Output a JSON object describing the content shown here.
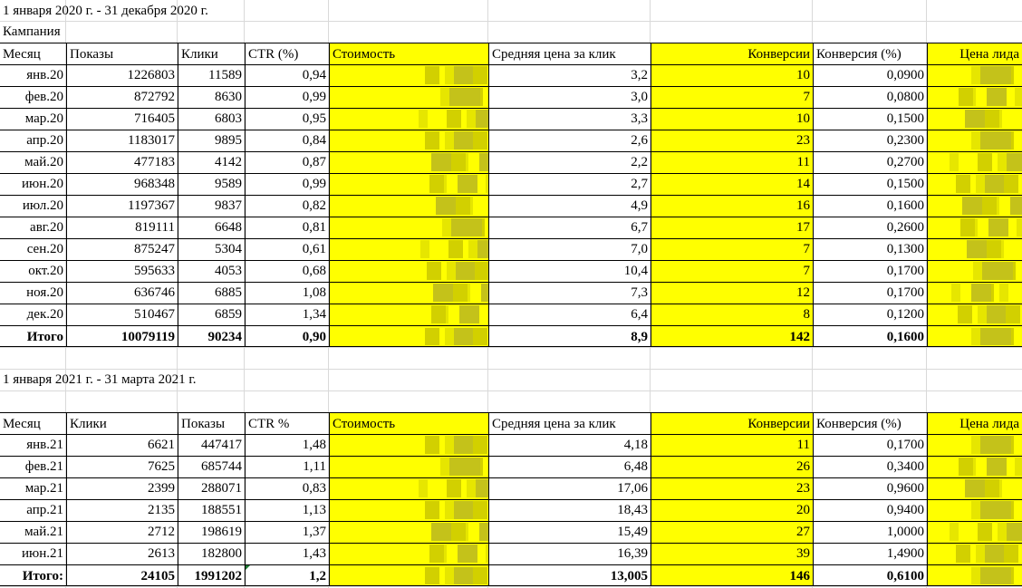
{
  "table1": {
    "title": "1 января 2020 г. - 31 декабря 2020 г.",
    "subtitle": "Кампания",
    "headers": [
      "Месяц",
      "Показы",
      "Клики",
      "CTR (%)",
      "Стоимость",
      "Средняя цена за клик",
      "Конверсии",
      "Конверсия (%)",
      "Цена лида"
    ],
    "rows": [
      [
        "янв.20",
        "1226803",
        "11589",
        "0,94",
        "",
        "3,2",
        "10",
        "0,0900",
        ""
      ],
      [
        "фев.20",
        "872792",
        "8630",
        "0,99",
        "",
        "3,0",
        "7",
        "0,0800",
        ""
      ],
      [
        "мар.20",
        "716405",
        "6803",
        "0,95",
        "",
        "3,3",
        "10",
        "0,1500",
        ""
      ],
      [
        "апр.20",
        "1183017",
        "9895",
        "0,84",
        "",
        "2,6",
        "23",
        "0,2300",
        ""
      ],
      [
        "май.20",
        "477183",
        "4142",
        "0,87",
        "",
        "2,2",
        "11",
        "0,2700",
        ""
      ],
      [
        "июн.20",
        "968348",
        "9589",
        "0,99",
        "",
        "2,7",
        "14",
        "0,1500",
        ""
      ],
      [
        "июл.20",
        "1197367",
        "9837",
        "0,82",
        "",
        "4,9",
        "16",
        "0,1600",
        ""
      ],
      [
        "авг.20",
        "819111",
        "6648",
        "0,81",
        "",
        "6,7",
        "17",
        "0,2600",
        ""
      ],
      [
        "сен.20",
        "875247",
        "5304",
        "0,61",
        "",
        "7,0",
        "7",
        "0,1300",
        ""
      ],
      [
        "окт.20",
        "595633",
        "4053",
        "0,68",
        "",
        "10,4",
        "7",
        "0,1700",
        ""
      ],
      [
        "ноя.20",
        "636746",
        "6885",
        "1,08",
        "",
        "7,3",
        "12",
        "0,1700",
        ""
      ],
      [
        "дек.20",
        "510467",
        "6859",
        "1,34",
        "",
        "6,4",
        "8",
        "0,1200",
        ""
      ]
    ],
    "total": [
      "Итого",
      "10079119",
      "90234",
      "0,90",
      "",
      "8,9",
      "142",
      "0,1600",
      ""
    ]
  },
  "table2": {
    "title": "1 января 2021 г. - 31 марта 2021 г.",
    "headers": [
      "Месяц",
      "Клики",
      "Показы",
      "CTR %",
      "Стоимость",
      "Средняя цена за клик",
      "Конверсии",
      "Конверсия (%)",
      "Цена лида"
    ],
    "rows": [
      [
        "янв.21",
        "6621",
        "447417",
        "1,48",
        "",
        "4,18",
        "11",
        "0,1700",
        ""
      ],
      [
        "фев.21",
        "7625",
        "685744",
        "1,11",
        "",
        "6,48",
        "26",
        "0,3400",
        ""
      ],
      [
        "мар.21",
        "2399",
        "288071",
        "0,83",
        "",
        "17,06",
        "23",
        "0,9600",
        ""
      ],
      [
        "апр.21",
        "2135",
        "188551",
        "1,13",
        "",
        "18,43",
        "20",
        "0,9400",
        ""
      ],
      [
        "май.21",
        "2712",
        "198619",
        "1,37",
        "",
        "15,49",
        "27",
        "1,0000",
        ""
      ],
      [
        "июн.21",
        "2613",
        "182800",
        "1,43",
        "",
        "16,39",
        "39",
        "1,4900",
        ""
      ]
    ],
    "total": [
      "Итого:",
      "24105",
      "1991202",
      "1,2",
      "",
      "13,005",
      "146",
      "0,6100",
      ""
    ]
  },
  "colors": {
    "highlight": "#ffff00",
    "blur_a": "#e6e600",
    "blur_b": "#d2d000",
    "blur_c": "#c4c21a",
    "grid": "#d9d9d9",
    "error_marker": "#1e7b34"
  }
}
